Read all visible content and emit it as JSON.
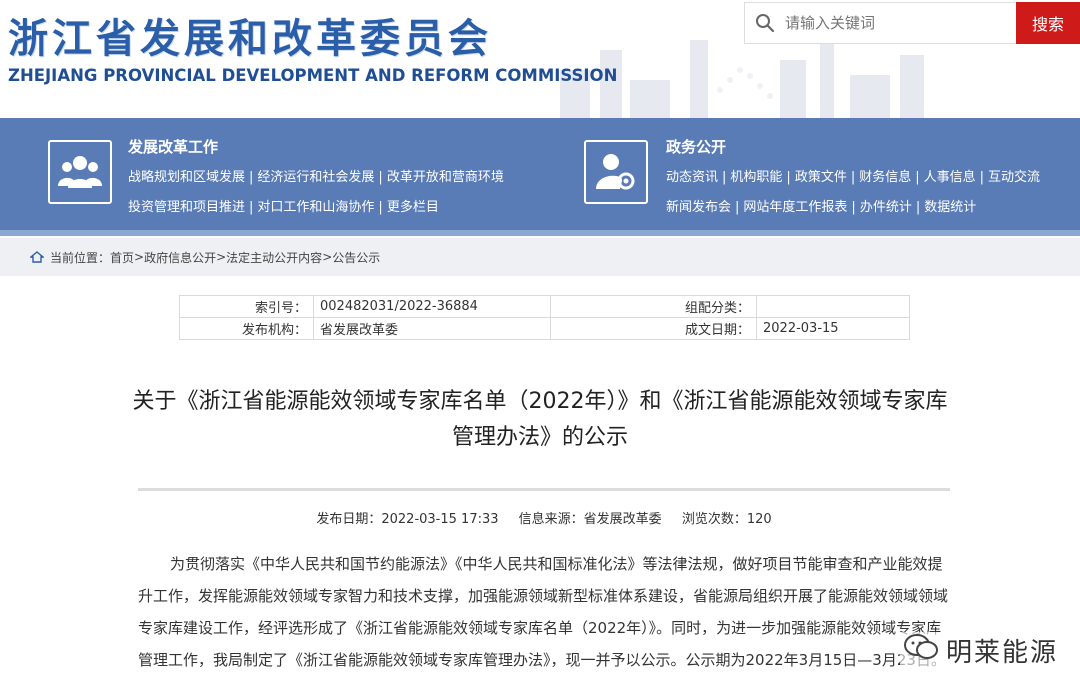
{
  "header": {
    "title_cn": "浙江省发展和改革委员会",
    "title_en": "ZHEJIANG PROVINCIAL DEVELOPMENT AND REFORM COMMISSION",
    "search_placeholder": "请输入关键词",
    "search_button": "搜索"
  },
  "nav": {
    "group1": {
      "title": "发展改革工作",
      "icon": "people-group-icon",
      "links_row1": [
        "战略规划和区域发展",
        "经济运行和社会发展",
        "改革开放和营商环境"
      ],
      "links_row2": [
        "投资管理和项目推进",
        "对口工作和山海协作",
        "更多栏目"
      ]
    },
    "group2": {
      "title": "政务公开",
      "icon": "user-gear-icon",
      "links_row1": [
        "动态资讯",
        "机构职能",
        "政策文件",
        "财务信息",
        "人事信息",
        "互动交流"
      ],
      "links_row2": [
        "新闻发布会",
        "网站年度工作报表",
        "办件统计",
        "数据统计"
      ]
    }
  },
  "breadcrumb": {
    "prefix": "当前位置：",
    "items": [
      "首页",
      "政府信息公开",
      "法定主动公开内容",
      "公告公示"
    ]
  },
  "info": {
    "index_label": "索引号：",
    "index_value": "002482031/2022-36884",
    "category_label": "组配分类：",
    "category_value": "",
    "publisher_label": "发布机构：",
    "publisher_value": "省发展改革委",
    "date_label": "成文日期：",
    "date_value": "2022-03-15"
  },
  "article": {
    "title": "关于《浙江省能源能效领域专家库名单（2022年）》和《浙江省能源能效领域专家库管理办法》的公示",
    "publish_date": "发布日期：2022-03-15 17:33",
    "source": "信息来源：省发展改革委",
    "views": "浏览次数：120",
    "body": "为贯彻落实《中华人民共和国节约能源法》《中华人民共和国标准化法》等法律法规，做好项目节能审查和产业能效提升工作，发挥能源能效领域专家智力和技术支撑，加强能源领域新型标准体系建设，省能源局组织开展了能源能效领域领域专家库建设工作，经评选形成了《浙江省能源能效领域专家库名单（2022年）》。同时，为进一步加强能源能效领域专家库管理工作，我局制定了《浙江省能源能效领域专家库管理办法》，现一并予以公示。公示期为2022年3月15日—3月23日。"
  },
  "watermark": {
    "text": "明莱能源"
  }
}
